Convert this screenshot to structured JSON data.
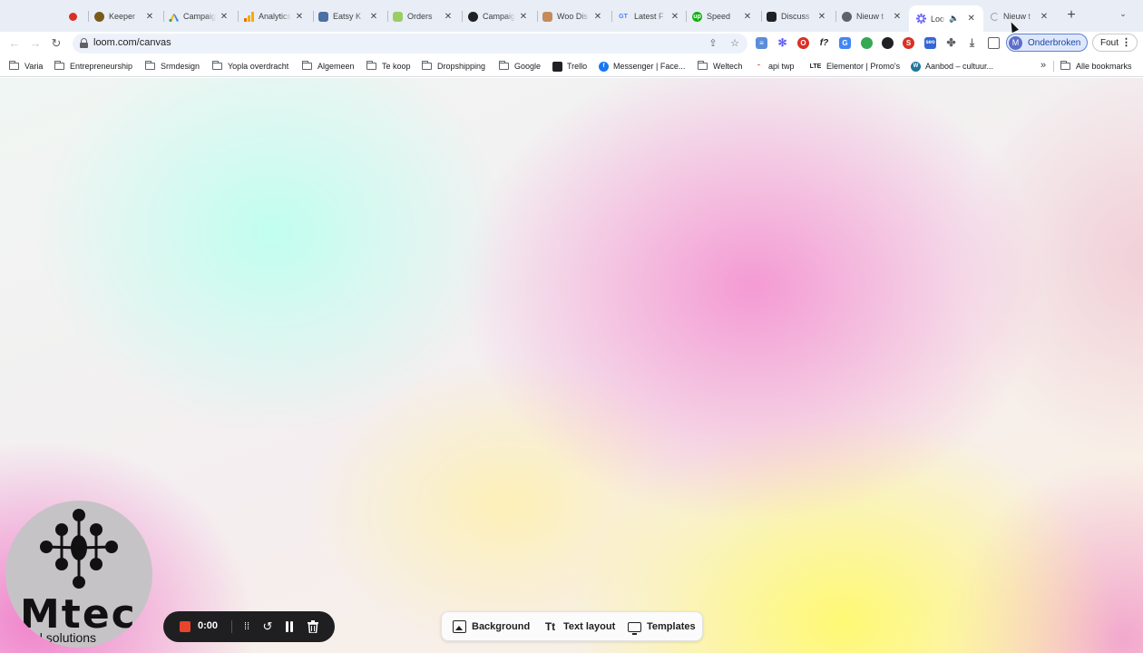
{
  "browser": {
    "tabs": [
      {
        "title": "",
        "favicon": "record-icon",
        "color": "#d93025"
      },
      {
        "title": "Keeper",
        "favicon": "keeper-icon",
        "color": "#7a5a1a"
      },
      {
        "title": "Campaign",
        "favicon": "google-ads-icon",
        "color": "#1a73e8"
      },
      {
        "title": "Analytics",
        "favicon": "analytics-icon",
        "color": "#f29900"
      },
      {
        "title": "Eatsy K",
        "favicon": "eatsy-icon",
        "color": "#4a6fa5"
      },
      {
        "title": "Orders",
        "favicon": "orders-icon",
        "color": "#9ccc65"
      },
      {
        "title": "Campaign",
        "favicon": "campaign-icon",
        "color": "#202124"
      },
      {
        "title": "Woo Dis",
        "favicon": "woo-icon",
        "color": "#c58b5a"
      },
      {
        "title": "Latest F",
        "favicon": "gt-icon",
        "color": "#4285f4"
      },
      {
        "title": "Speed",
        "favicon": "speed-icon",
        "color": "#0fb10f"
      },
      {
        "title": "Discuss",
        "favicon": "discuss-icon",
        "color": "#202124"
      },
      {
        "title": "Nieuw t",
        "favicon": "chrome-icon",
        "color": "#5f6368"
      },
      {
        "title": "Loo",
        "favicon": "loom-icon",
        "color": "#625df5",
        "active": true
      },
      {
        "title": "Nieuw t",
        "favicon": "loading-icon",
        "color": "#9aa0a6"
      }
    ],
    "url": "loom.com/canvas",
    "profile": {
      "initial": "M",
      "label": "Onderbroken"
    },
    "error_button": "Fout",
    "bookmarks": [
      {
        "label": "Varia",
        "type": "folder"
      },
      {
        "label": "Entrepreneurship",
        "type": "folder"
      },
      {
        "label": "Srmdesign",
        "type": "folder"
      },
      {
        "label": "Yopla overdracht",
        "type": "folder"
      },
      {
        "label": "Algemeen",
        "type": "folder"
      },
      {
        "label": "Te koop",
        "type": "folder"
      },
      {
        "label": "Dropshipping",
        "type": "folder"
      },
      {
        "label": "Google",
        "type": "folder"
      },
      {
        "label": "Trello",
        "type": "site",
        "icon": "trello-icon"
      },
      {
        "label": "Messenger | Face...",
        "type": "site",
        "icon": "facebook-icon"
      },
      {
        "label": "Weltech",
        "type": "folder"
      },
      {
        "label": "api twp",
        "type": "site",
        "icon": "api-icon"
      },
      {
        "label": "Elementor | Promo's",
        "type": "site",
        "icon": "lte-icon"
      },
      {
        "label": "Aanbod – cultuur...",
        "type": "site",
        "icon": "wordpress-icon"
      }
    ],
    "bookmarks_more": "»",
    "all_bookmarks": "Alle bookmarks"
  },
  "camera": {
    "logo_text": "Mtec",
    "logo_sub": "Digital solutions"
  },
  "recorder": {
    "timer": "0:00"
  },
  "canvas_toolbar": {
    "background_label": "Background",
    "text_layout_label": "Text layout",
    "templates_label": "Templates"
  }
}
